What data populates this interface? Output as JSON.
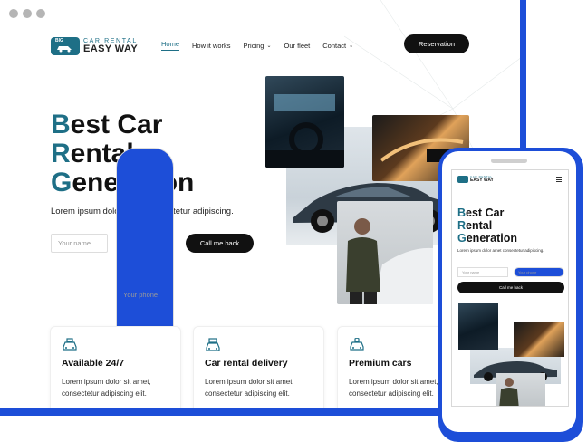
{
  "brand": {
    "badge": "BIG",
    "small": "CAR RENTAL",
    "big": "EASY WAY"
  },
  "nav": {
    "items": [
      {
        "label": "Home",
        "active": true,
        "dropdown": false
      },
      {
        "label": "How it works",
        "active": false,
        "dropdown": false
      },
      {
        "label": "Pricing",
        "active": false,
        "dropdown": true
      },
      {
        "label": "Our fleet",
        "active": false,
        "dropdown": false
      },
      {
        "label": "Contact",
        "active": false,
        "dropdown": true
      }
    ],
    "reservation_label": "Reservation"
  },
  "hero": {
    "line1_cap": "B",
    "line1_rest": "est Car",
    "line2_cap": "R",
    "line2_rest": "ental",
    "line3_cap": "G",
    "line3_rest": "eneration",
    "subtitle": "Lorem ipsum dolor amet consectetur adipiscing.",
    "name_placeholder": "Your name",
    "phone_placeholder": "Your phone",
    "call_label": "Call me back"
  },
  "features": [
    {
      "title": "Available 24/7",
      "text": "Lorem ipsum dolor sit amet, consectetur adipiscing elit.",
      "icon": "taxi-icon"
    },
    {
      "title": "Car rental delivery",
      "text": "Lorem ipsum dolor sit amet, consectetur adipiscing elit.",
      "icon": "delivery-car-icon"
    },
    {
      "title": "Premium cars",
      "text": "Lorem ipsum dolor sit amet, consectetur adipiscing elit.",
      "icon": "premium-car-icon"
    }
  ],
  "colors": {
    "accent": "#1e6f86",
    "frame": "#1d4ed8",
    "button": "#111111"
  }
}
